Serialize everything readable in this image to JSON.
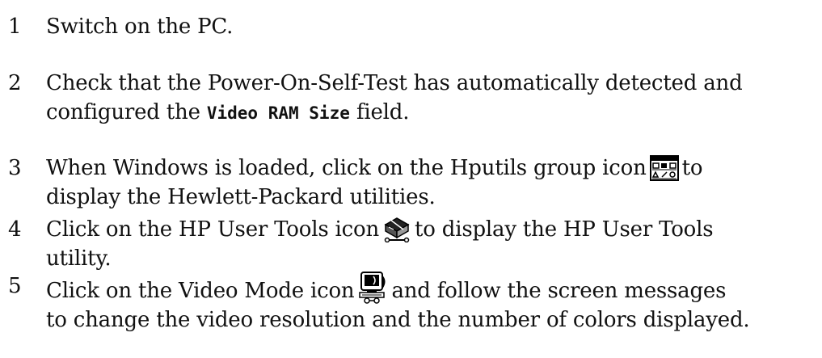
{
  "steps": [
    {
      "number": "1",
      "text": "Switch on the PC."
    },
    {
      "number": "2",
      "line1": "Check that the Power-On-Self-Test has automatically detected and",
      "line2_before": "configured the ",
      "code": "Video RAM Size",
      "line2_after": " field."
    },
    {
      "number": "3",
      "line1_before": "When Windows is loaded, click on the Hputils group icon",
      "icon": "hputils-group-icon",
      "line1_after": "to",
      "line2": "display the Hewlett-Packard utilities."
    },
    {
      "number": "4",
      "line1_before": "Click on the HP User Tools icon",
      "icon": "hp-user-tools-icon",
      "line1_after": "to display the HP User Tools",
      "line2": "utility."
    },
    {
      "number": "5",
      "line1_before": "Click on the Video Mode icon",
      "icon": "video-mode-icon",
      "line1_after": "and follow the screen messages",
      "line2": "to change the video resolution and the number of colors displayed."
    }
  ]
}
